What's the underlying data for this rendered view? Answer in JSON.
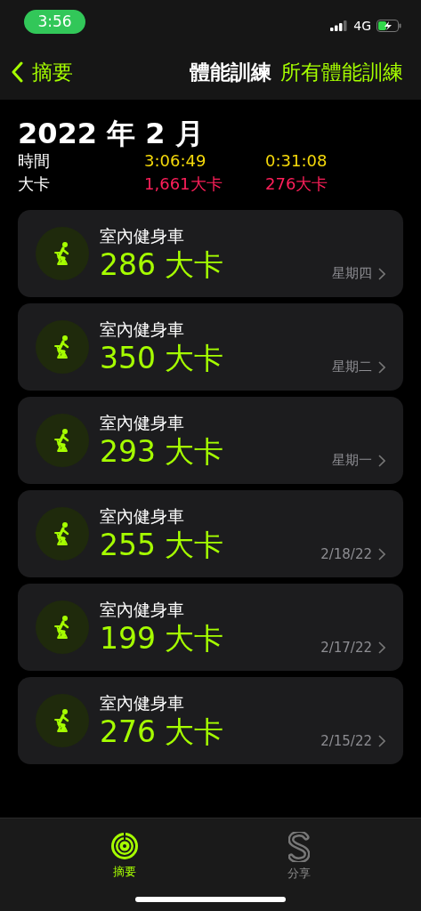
{
  "status_bar": {
    "time": "3:56",
    "network": "4G"
  },
  "nav": {
    "back": "摘要",
    "title": "體能訓練",
    "action": "所有體能訓練"
  },
  "month": {
    "title": "2022 年 2 月",
    "rows": [
      {
        "label": "時間",
        "values": [
          "3:06:49",
          "0:31:08"
        ],
        "kind": "time"
      },
      {
        "label": "大卡",
        "values": [
          "1,661大卡",
          "276大卡"
        ],
        "kind": "calories"
      }
    ]
  },
  "workouts": [
    {
      "name": "室內健身車",
      "calories": "286 大卡",
      "date": "星期四"
    },
    {
      "name": "室內健身車",
      "calories": "350 大卡",
      "date": "星期二"
    },
    {
      "name": "室內健身車",
      "calories": "293 大卡",
      "date": "星期一"
    },
    {
      "name": "室內健身車",
      "calories": "255 大卡",
      "date": "2/18/22"
    },
    {
      "name": "室內健身車",
      "calories": "199 大卡",
      "date": "2/17/22"
    },
    {
      "name": "室內健身車",
      "calories": "276 大卡",
      "date": "2/15/22"
    }
  ],
  "tabs": [
    {
      "label": "摘要",
      "selected": true,
      "kind": "summary"
    },
    {
      "label": "分享",
      "selected": false,
      "kind": "sharing"
    }
  ]
}
